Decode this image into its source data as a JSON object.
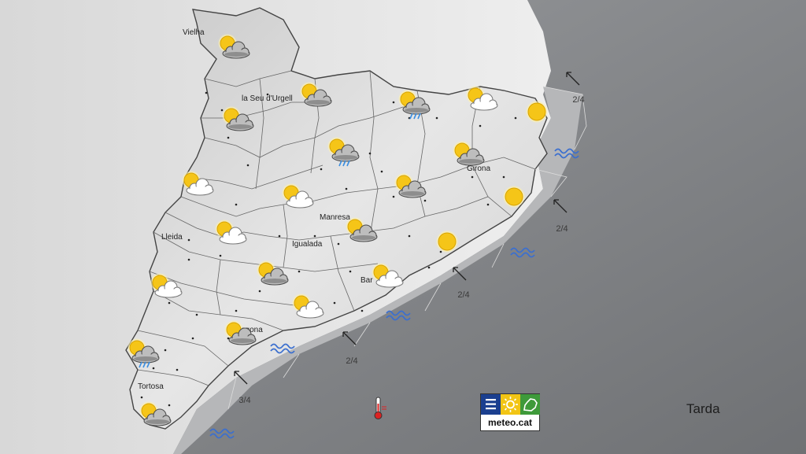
{
  "period_label": "Tarda",
  "logo_text": "meteo.cat",
  "colors": {
    "sea": "#7d7f82",
    "land": "#dcdcdc",
    "border": "#555555",
    "sun": "#f5c518",
    "cloud_dark": "#6e6e6e",
    "cloud_light": "#ffffff",
    "wave": "#3b6fcf",
    "rain": "#3a8de0"
  },
  "cities": [
    {
      "name": "Vielha"
    },
    {
      "name": "la Seu d'Urgell"
    },
    {
      "name": "Girona"
    },
    {
      "name": "Manresa"
    },
    {
      "name": "Lleida"
    },
    {
      "name": "Igualada"
    },
    {
      "name": "Bar"
    },
    {
      "name": "agona"
    },
    {
      "name": "Tortosa"
    }
  ],
  "forecasts": [
    {
      "icon": "sun-cloud-dark-icon"
    },
    {
      "icon": "sun-cloud-dark-icon"
    },
    {
      "icon": "sun-cloud-rain-icon"
    },
    {
      "icon": "sun-cloud-light-icon"
    },
    {
      "icon": "sun-cloud-dark-icon"
    },
    {
      "icon": "sun-icon"
    },
    {
      "icon": "sun-cloud-rain-icon"
    },
    {
      "icon": "sun-cloud-dark-icon"
    },
    {
      "icon": "sun-cloud-light-icon"
    },
    {
      "icon": "sun-cloud-light-icon"
    },
    {
      "icon": "sun-cloud-dark-icon"
    },
    {
      "icon": "sun-icon"
    },
    {
      "icon": "sun-cloud-light-icon"
    },
    {
      "icon": "sun-cloud-dark-icon"
    },
    {
      "icon": "sun-icon"
    },
    {
      "icon": "sun-cloud-light-icon"
    },
    {
      "icon": "sun-cloud-dark-icon"
    },
    {
      "icon": "sun-cloud-light-icon"
    },
    {
      "icon": "sun-cloud-light-icon"
    },
    {
      "icon": "sun-cloud-dark-icon"
    },
    {
      "icon": "sun-cloud-rain-icon"
    },
    {
      "icon": "sun-cloud-dark-icon"
    }
  ],
  "sea_states": [
    {
      "label": "2/4",
      "icon": "wind-arrow-icon"
    },
    {
      "label": "2/4",
      "icon": "wind-arrow-icon"
    },
    {
      "label": "2/4",
      "icon": "wind-arrow-icon"
    },
    {
      "label": "2/4",
      "icon": "wind-arrow-icon"
    },
    {
      "label": "3/4",
      "icon": "wind-arrow-icon"
    }
  ],
  "wave_icons": [
    {
      "icon": "waves-icon"
    },
    {
      "icon": "waves-icon"
    },
    {
      "icon": "waves-icon"
    },
    {
      "icon": "waves-icon"
    },
    {
      "icon": "waves-icon"
    }
  ],
  "thermometer_icon": "thermometer-icon"
}
